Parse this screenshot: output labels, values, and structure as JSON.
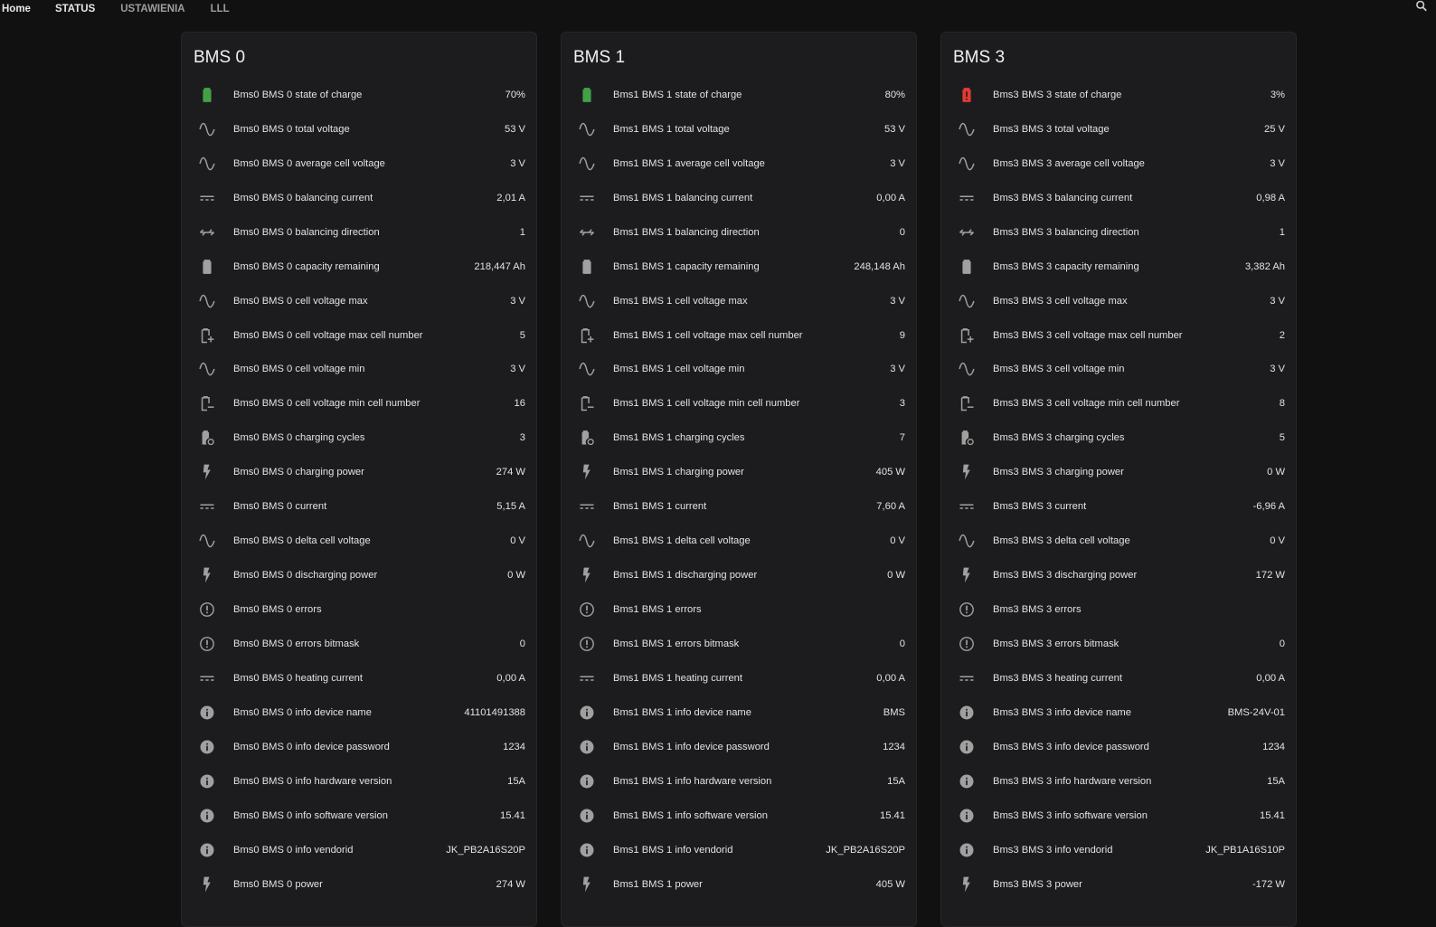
{
  "nav": {
    "tabs": [
      "Home",
      "STATUS",
      "USTAWIENIA",
      "LLL"
    ]
  },
  "colors": {
    "background": "#111111",
    "card": "#1c1c1e",
    "icon": "#a0a0a0",
    "battery_ok": "#43a047",
    "battery_low": "#e53935"
  },
  "cards": [
    {
      "title": "BMS 0",
      "rows": [
        {
          "icon": "battery-icon",
          "label": "Bms0 BMS 0 state of charge",
          "value": "70%"
        },
        {
          "icon": "sine-wave-icon",
          "label": "Bms0 BMS 0 total voltage",
          "value": "53 V"
        },
        {
          "icon": "sine-wave-icon",
          "label": "Bms0 BMS 0 average cell voltage",
          "value": "3 V"
        },
        {
          "icon": "dc-current-icon",
          "label": "Bms0 BMS 0 balancing current",
          "value": "2,01 A"
        },
        {
          "icon": "direction-arrows-icon",
          "label": "Bms0 BMS 0 balancing direction",
          "value": "1"
        },
        {
          "icon": "battery-icon",
          "label": "Bms0 BMS 0 capacity remaining",
          "value": "218,447 Ah"
        },
        {
          "icon": "sine-wave-icon",
          "label": "Bms0 BMS 0 cell voltage max",
          "value": "3 V"
        },
        {
          "icon": "battery-plus-icon",
          "label": "Bms0 BMS 0 cell voltage max cell number",
          "value": "5"
        },
        {
          "icon": "sine-wave-icon",
          "label": "Bms0 BMS 0 cell voltage min",
          "value": "3 V"
        },
        {
          "icon": "battery-minus-icon",
          "label": "Bms0 BMS 0 cell voltage min cell number",
          "value": "16"
        },
        {
          "icon": "battery-sync-icon",
          "label": "Bms0 BMS 0 charging cycles",
          "value": "3"
        },
        {
          "icon": "flash-icon",
          "label": "Bms0 BMS 0 charging power",
          "value": "274 W"
        },
        {
          "icon": "dc-current-icon",
          "label": "Bms0 BMS 0 current",
          "value": "5,15 A"
        },
        {
          "icon": "sine-wave-icon",
          "label": "Bms0 BMS 0 delta cell voltage",
          "value": "0 V"
        },
        {
          "icon": "flash-icon",
          "label": "Bms0 BMS 0 discharging power",
          "value": "0 W"
        },
        {
          "icon": "alert-circle-icon",
          "label": "Bms0 BMS 0 errors",
          "value": ""
        },
        {
          "icon": "alert-circle-icon",
          "label": "Bms0 BMS 0 errors bitmask",
          "value": "0"
        },
        {
          "icon": "dc-current-icon",
          "label": "Bms0 BMS 0 heating current",
          "value": "0,00 A"
        },
        {
          "icon": "info-icon",
          "label": "Bms0 BMS 0 info device name",
          "value": "41101491388"
        },
        {
          "icon": "info-icon",
          "label": "Bms0 BMS 0 info device password",
          "value": "1234"
        },
        {
          "icon": "info-icon",
          "label": "Bms0 BMS 0 info hardware version",
          "value": "15A"
        },
        {
          "icon": "info-icon",
          "label": "Bms0 BMS 0 info software version",
          "value": "15.41"
        },
        {
          "icon": "info-icon",
          "label": "Bms0 BMS 0 info vendorid",
          "value": "JK_PB2A16S20P"
        },
        {
          "icon": "flash-icon",
          "label": "Bms0 BMS 0 power",
          "value": "274 W"
        }
      ]
    },
    {
      "title": "BMS 1",
      "rows": [
        {
          "icon": "battery-icon",
          "label": "Bms1 BMS 1 state of charge",
          "value": "80%"
        },
        {
          "icon": "sine-wave-icon",
          "label": "Bms1 BMS 1 total voltage",
          "value": "53 V"
        },
        {
          "icon": "sine-wave-icon",
          "label": "Bms1 BMS 1 average cell voltage",
          "value": "3 V"
        },
        {
          "icon": "dc-current-icon",
          "label": "Bms1 BMS 1 balancing current",
          "value": "0,00 A"
        },
        {
          "icon": "direction-arrows-icon",
          "label": "Bms1 BMS 1 balancing direction",
          "value": "0"
        },
        {
          "icon": "battery-icon",
          "label": "Bms1 BMS 1 capacity remaining",
          "value": "248,148 Ah"
        },
        {
          "icon": "sine-wave-icon",
          "label": "Bms1 BMS 1 cell voltage max",
          "value": "3 V"
        },
        {
          "icon": "battery-plus-icon",
          "label": "Bms1 BMS 1 cell voltage max cell number",
          "value": "9"
        },
        {
          "icon": "sine-wave-icon",
          "label": "Bms1 BMS 1 cell voltage min",
          "value": "3 V"
        },
        {
          "icon": "battery-minus-icon",
          "label": "Bms1 BMS 1 cell voltage min cell number",
          "value": "3"
        },
        {
          "icon": "battery-sync-icon",
          "label": "Bms1 BMS 1 charging cycles",
          "value": "7"
        },
        {
          "icon": "flash-icon",
          "label": "Bms1 BMS 1 charging power",
          "value": "405 W"
        },
        {
          "icon": "dc-current-icon",
          "label": "Bms1 BMS 1 current",
          "value": "7,60 A"
        },
        {
          "icon": "sine-wave-icon",
          "label": "Bms1 BMS 1 delta cell voltage",
          "value": "0 V"
        },
        {
          "icon": "flash-icon",
          "label": "Bms1 BMS 1 discharging power",
          "value": "0 W"
        },
        {
          "icon": "alert-circle-icon",
          "label": "Bms1 BMS 1 errors",
          "value": ""
        },
        {
          "icon": "alert-circle-icon",
          "label": "Bms1 BMS 1 errors bitmask",
          "value": "0"
        },
        {
          "icon": "dc-current-icon",
          "label": "Bms1 BMS 1 heating current",
          "value": "0,00 A"
        },
        {
          "icon": "info-icon",
          "label": "Bms1 BMS 1 info device name",
          "value": "BMS"
        },
        {
          "icon": "info-icon",
          "label": "Bms1 BMS 1 info device password",
          "value": "1234"
        },
        {
          "icon": "info-icon",
          "label": "Bms1 BMS 1 info hardware version",
          "value": "15A"
        },
        {
          "icon": "info-icon",
          "label": "Bms1 BMS 1 info software version",
          "value": "15.41"
        },
        {
          "icon": "info-icon",
          "label": "Bms1 BMS 1 info vendorid",
          "value": "JK_PB2A16S20P"
        },
        {
          "icon": "flash-icon",
          "label": "Bms1 BMS 1 power",
          "value": "405 W"
        }
      ]
    },
    {
      "title": "BMS 3",
      "rows": [
        {
          "icon": "battery-alert-icon",
          "label": "Bms3 BMS 3 state of charge",
          "value": "3%"
        },
        {
          "icon": "sine-wave-icon",
          "label": "Bms3 BMS 3 total voltage",
          "value": "25 V"
        },
        {
          "icon": "sine-wave-icon",
          "label": "Bms3 BMS 3 average cell voltage",
          "value": "3 V"
        },
        {
          "icon": "dc-current-icon",
          "label": "Bms3 BMS 3 balancing current",
          "value": "0,98 A"
        },
        {
          "icon": "direction-arrows-icon",
          "label": "Bms3 BMS 3 balancing direction",
          "value": "1"
        },
        {
          "icon": "battery-icon",
          "label": "Bms3 BMS 3 capacity remaining",
          "value": "3,382 Ah"
        },
        {
          "icon": "sine-wave-icon",
          "label": "Bms3 BMS 3 cell voltage max",
          "value": "3 V"
        },
        {
          "icon": "battery-plus-icon",
          "label": "Bms3 BMS 3 cell voltage max cell number",
          "value": "2"
        },
        {
          "icon": "sine-wave-icon",
          "label": "Bms3 BMS 3 cell voltage min",
          "value": "3 V"
        },
        {
          "icon": "battery-minus-icon",
          "label": "Bms3 BMS 3 cell voltage min cell number",
          "value": "8"
        },
        {
          "icon": "battery-sync-icon",
          "label": "Bms3 BMS 3 charging cycles",
          "value": "5"
        },
        {
          "icon": "flash-icon",
          "label": "Bms3 BMS 3 charging power",
          "value": "0 W"
        },
        {
          "icon": "dc-current-icon",
          "label": "Bms3 BMS 3 current",
          "value": "-6,96 A"
        },
        {
          "icon": "sine-wave-icon",
          "label": "Bms3 BMS 3 delta cell voltage",
          "value": "0 V"
        },
        {
          "icon": "flash-icon",
          "label": "Bms3 BMS 3 discharging power",
          "value": "172 W"
        },
        {
          "icon": "alert-circle-icon",
          "label": "Bms3 BMS 3 errors",
          "value": ""
        },
        {
          "icon": "alert-circle-icon",
          "label": "Bms3 BMS 3 errors bitmask",
          "value": "0"
        },
        {
          "icon": "dc-current-icon",
          "label": "Bms3 BMS 3 heating current",
          "value": "0,00 A"
        },
        {
          "icon": "info-icon",
          "label": "Bms3 BMS 3 info device name",
          "value": "BMS-24V-01"
        },
        {
          "icon": "info-icon",
          "label": "Bms3 BMS 3 info device password",
          "value": "1234"
        },
        {
          "icon": "info-icon",
          "label": "Bms3 BMS 3 info hardware version",
          "value": "15A"
        },
        {
          "icon": "info-icon",
          "label": "Bms3 BMS 3 info software version",
          "value": "15.41"
        },
        {
          "icon": "info-icon",
          "label": "Bms3 BMS 3 info vendorid",
          "value": "JK_PB1A16S10P"
        },
        {
          "icon": "flash-icon",
          "label": "Bms3 BMS 3 power",
          "value": "-172 W"
        }
      ]
    }
  ]
}
